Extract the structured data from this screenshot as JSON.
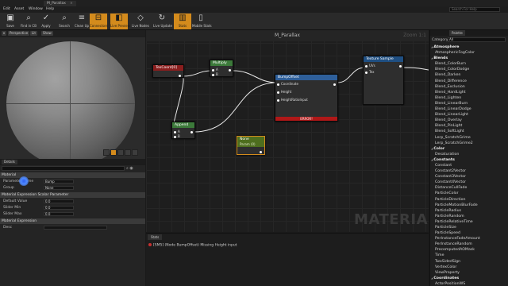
{
  "window": {
    "tab_title": "M_Parallax"
  },
  "menu": {
    "items": [
      "Edit",
      "Asset",
      "Window",
      "Help"
    ],
    "help_search_placeholder": "Search For Help"
  },
  "toolbar": {
    "buttons": [
      {
        "label": "Save",
        "icon": "save-icon"
      },
      {
        "label": "Find in CB",
        "icon": "find-in-content-browser-icon"
      },
      {
        "label": "Apply",
        "icon": "apply-icon"
      },
      {
        "label": "Search",
        "icon": "search-icon"
      },
      {
        "label": "Clean Up",
        "icon": "clean-up-icon"
      },
      {
        "label": "Connectors",
        "icon": "connectors-icon"
      },
      {
        "label": "Live Preview",
        "icon": "live-preview-icon"
      },
      {
        "label": "Live Nodes",
        "icon": "live-nodes-icon"
      },
      {
        "label": "Live Update",
        "icon": "live-update-icon"
      },
      {
        "label": "Stats",
        "icon": "stats-icon"
      },
      {
        "label": "Mobile Stats",
        "icon": "mobile-stats-icon"
      }
    ]
  },
  "viewport": {
    "perspective_label": "Perspective",
    "lit_label": "Lit",
    "show_label": "Show"
  },
  "details": {
    "tab_label": "Details",
    "material_section": "Material",
    "param_name_label": "Parameter Name",
    "param_name_value": "Bump",
    "group_label": "Group",
    "group_value": "None",
    "scalar_section": "Material Expression Scalar Parameter",
    "default_value_label": "Default Value",
    "default_value": "0.0",
    "slider_min_label": "Slider Min",
    "slider_min": "0.0",
    "slider_max_label": "Slider Max",
    "slider_max": "0.0",
    "expression_section": "Material Expression",
    "desc_label": "Desc"
  },
  "graph": {
    "title": "M_Parallax",
    "zoom": "Zoom 1:1",
    "watermark": "MATERIAL",
    "nodes": {
      "texcoord": {
        "title": "TexCoord[0]"
      },
      "multiply": {
        "title": "Multiply",
        "pin_a": "A",
        "pin_b": "B"
      },
      "append": {
        "title": "Append",
        "pin_a": "A",
        "pin_b": "B"
      },
      "bumpoffset": {
        "title": "BumpOffset",
        "pin_coord": "Coordinate",
        "pin_height": "Height",
        "pin_ratio": "HeightRatioInput",
        "error": "ERROR!"
      },
      "texsample": {
        "title": "Texture Sample",
        "pin_uvs": "UVs",
        "pin_tex": "Tex"
      },
      "bump_param": {
        "title": "None",
        "subtitle": "Param (0)"
      }
    }
  },
  "stats": {
    "tab_label": "Stats",
    "message": "[SM5] (Node BumpOffset) Missing Height input"
  },
  "palette": {
    "tab_label": "Palette",
    "category_label": "Category",
    "category_value": "All",
    "items": [
      {
        "label": "Atmosphere",
        "cat": true
      },
      {
        "label": "AtmosphericFogColor",
        "cat": false
      },
      {
        "label": "Blends",
        "cat": true
      },
      {
        "label": "Blend_ColorBurn",
        "cat": false
      },
      {
        "label": "Blend_ColorDodge",
        "cat": false
      },
      {
        "label": "Blend_Darken",
        "cat": false
      },
      {
        "label": "Blend_Difference",
        "cat": false
      },
      {
        "label": "Blend_Exclusion",
        "cat": false
      },
      {
        "label": "Blend_HardLight",
        "cat": false
      },
      {
        "label": "Blend_Lighten",
        "cat": false
      },
      {
        "label": "Blend_LinearBurn",
        "cat": false
      },
      {
        "label": "Blend_LinearDodge",
        "cat": false
      },
      {
        "label": "Blend_LinearLight",
        "cat": false
      },
      {
        "label": "Blend_Overlay",
        "cat": false
      },
      {
        "label": "Blend_PinLight",
        "cat": false
      },
      {
        "label": "Blend_SoftLight",
        "cat": false
      },
      {
        "label": "Lerp_ScratchGrime",
        "cat": false
      },
      {
        "label": "Lerp_ScratchGrime2",
        "cat": false
      },
      {
        "label": "Color",
        "cat": true
      },
      {
        "label": "Desaturation",
        "cat": false
      },
      {
        "label": "Constants",
        "cat": true
      },
      {
        "label": "Constant",
        "cat": false
      },
      {
        "label": "Constant2Vector",
        "cat": false
      },
      {
        "label": "Constant3Vector",
        "cat": false
      },
      {
        "label": "Constant4Vector",
        "cat": false
      },
      {
        "label": "DistanceCullFade",
        "cat": false
      },
      {
        "label": "ParticleColor",
        "cat": false
      },
      {
        "label": "ParticleDirection",
        "cat": false
      },
      {
        "label": "ParticleMotionBlurFade",
        "cat": false
      },
      {
        "label": "ParticleRadius",
        "cat": false
      },
      {
        "label": "ParticleRandom",
        "cat": false
      },
      {
        "label": "ParticleRelativeTime",
        "cat": false
      },
      {
        "label": "ParticleSize",
        "cat": false
      },
      {
        "label": "ParticleSpeed",
        "cat": false
      },
      {
        "label": "PerInstanceFadeAmount",
        "cat": false
      },
      {
        "label": "PerInstanceRandom",
        "cat": false
      },
      {
        "label": "PrecomputedAOMask",
        "cat": false
      },
      {
        "label": "Time",
        "cat": false
      },
      {
        "label": "TwoSidedSign",
        "cat": false
      },
      {
        "label": "VertexColor",
        "cat": false
      },
      {
        "label": "ViewProperty",
        "cat": false
      },
      {
        "label": "Coordinates",
        "cat": true
      },
      {
        "label": "ActorPositionWS",
        "cat": false
      },
      {
        "label": "BlurSampleOffsets",
        "cat": false
      },
      {
        "label": "CameraPositionWS",
        "cat": false
      }
    ]
  },
  "colors": {
    "active_orange": "#d48b1c",
    "texcoord_header": "#8a1e1e",
    "math_header": "#3c7a3a",
    "bumpoffset_header": "#2e5f9a",
    "texsample_header": "#1f4f82",
    "param_header": "#4e6e1e",
    "error_bar": "#b01818"
  }
}
